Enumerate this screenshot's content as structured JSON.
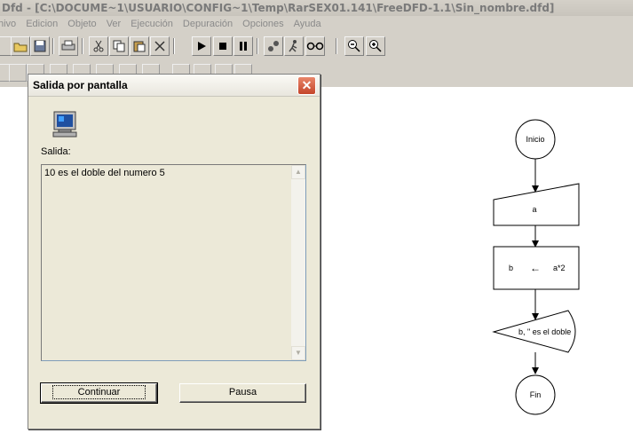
{
  "window": {
    "title": "Dfd - [C:\\DOCUME~1\\USUARIO\\CONFIG~1\\Temp\\RarSEX01.141\\FreeDFD-1.1\\Sin_nombre.dfd]"
  },
  "menu": [
    "hivo",
    "Edicion",
    "Objeto",
    "Ver",
    "Ejecución",
    "Depuración",
    "Opciones",
    "Ayuda"
  ],
  "dialog": {
    "title": "Salida por pantalla",
    "close": "✕",
    "output_label": "Salida:",
    "output_text": "10 es el doble del numero 5",
    "continue_button": "Continuar",
    "pause_button": "Pausa"
  },
  "flowchart": {
    "start": "Inicio",
    "read": "a",
    "assign_target": "b",
    "assign_arrow": "←",
    "assign_expr": "a*2",
    "output": "b, \" es el doble",
    "end": "Fin"
  },
  "colors": {
    "chrome": "#d4d0c8",
    "dialog_bg": "#ece9d8",
    "close_red": "#c4452a"
  }
}
